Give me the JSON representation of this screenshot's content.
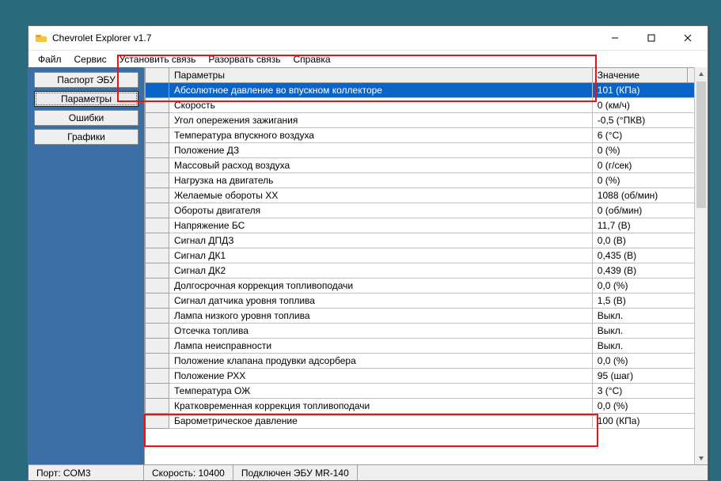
{
  "window": {
    "title": "Chevrolet Explorer v1.7"
  },
  "menu": {
    "file": "Файл",
    "service": "Сервис",
    "connect": "Установить связь",
    "disconnect": "Разорвать связь",
    "help": "Справка"
  },
  "sidebar": {
    "passport": "Паспорт ЭБУ",
    "params": "Параметры",
    "errors": "Ошибки",
    "charts": "Графики"
  },
  "grid": {
    "col_param": "Параметры",
    "col_value": "Значение",
    "rows": [
      {
        "p": "Абсолютное давление во впускном коллекторе",
        "v": "101  (КПа)"
      },
      {
        "p": "Скорость",
        "v": "0  (км/ч)"
      },
      {
        "p": "Угол опережения зажигания",
        "v": "-0,5  (°ПКВ)"
      },
      {
        "p": "Температура впускного воздуха",
        "v": "6  (°C)"
      },
      {
        "p": "Положение ДЗ",
        "v": "0  (%)"
      },
      {
        "p": "Массовый расход воздуха",
        "v": "0  (г/сек)"
      },
      {
        "p": "Нагрузка на двигатель",
        "v": "0  (%)"
      },
      {
        "p": "Желаемые обороты ХХ",
        "v": "1088  (об/мин)"
      },
      {
        "p": "Обороты двигателя",
        "v": "0  (об/мин)"
      },
      {
        "p": "Напряжение БС",
        "v": "11,7  (В)"
      },
      {
        "p": "Сигнал ДПДЗ",
        "v": "0,0  (В)"
      },
      {
        "p": "Сигнал ДК1",
        "v": "0,435  (В)"
      },
      {
        "p": "Сигнал ДК2",
        "v": "0,439  (В)"
      },
      {
        "p": "Долгосрочная коррекция топливоподачи",
        "v": "0,0  (%)"
      },
      {
        "p": "Сигнал датчика уровня топлива",
        "v": "1,5  (В)"
      },
      {
        "p": "Лампа низкого уровня топлива",
        "v": "Выкл."
      },
      {
        "p": "Отсечка топлива",
        "v": "Выкл."
      },
      {
        "p": "Лампа неисправности",
        "v": "Выкл."
      },
      {
        "p": "Положение клапана продувки адсорбера",
        "v": "0,0  (%)"
      },
      {
        "p": "Положение РХХ",
        "v": "95  (шаг)"
      },
      {
        "p": "Температура ОЖ",
        "v": "3  (°C)"
      },
      {
        "p": "Кратковременная коррекция топливоподачи",
        "v": "0,0  (%)"
      },
      {
        "p": "Барометрическое давление",
        "v": "100  (КПа)"
      }
    ]
  },
  "status": {
    "port": "Порт: COM3",
    "speed": "Скорость: 10400",
    "conn": "Подключен ЭБУ MR-140"
  }
}
